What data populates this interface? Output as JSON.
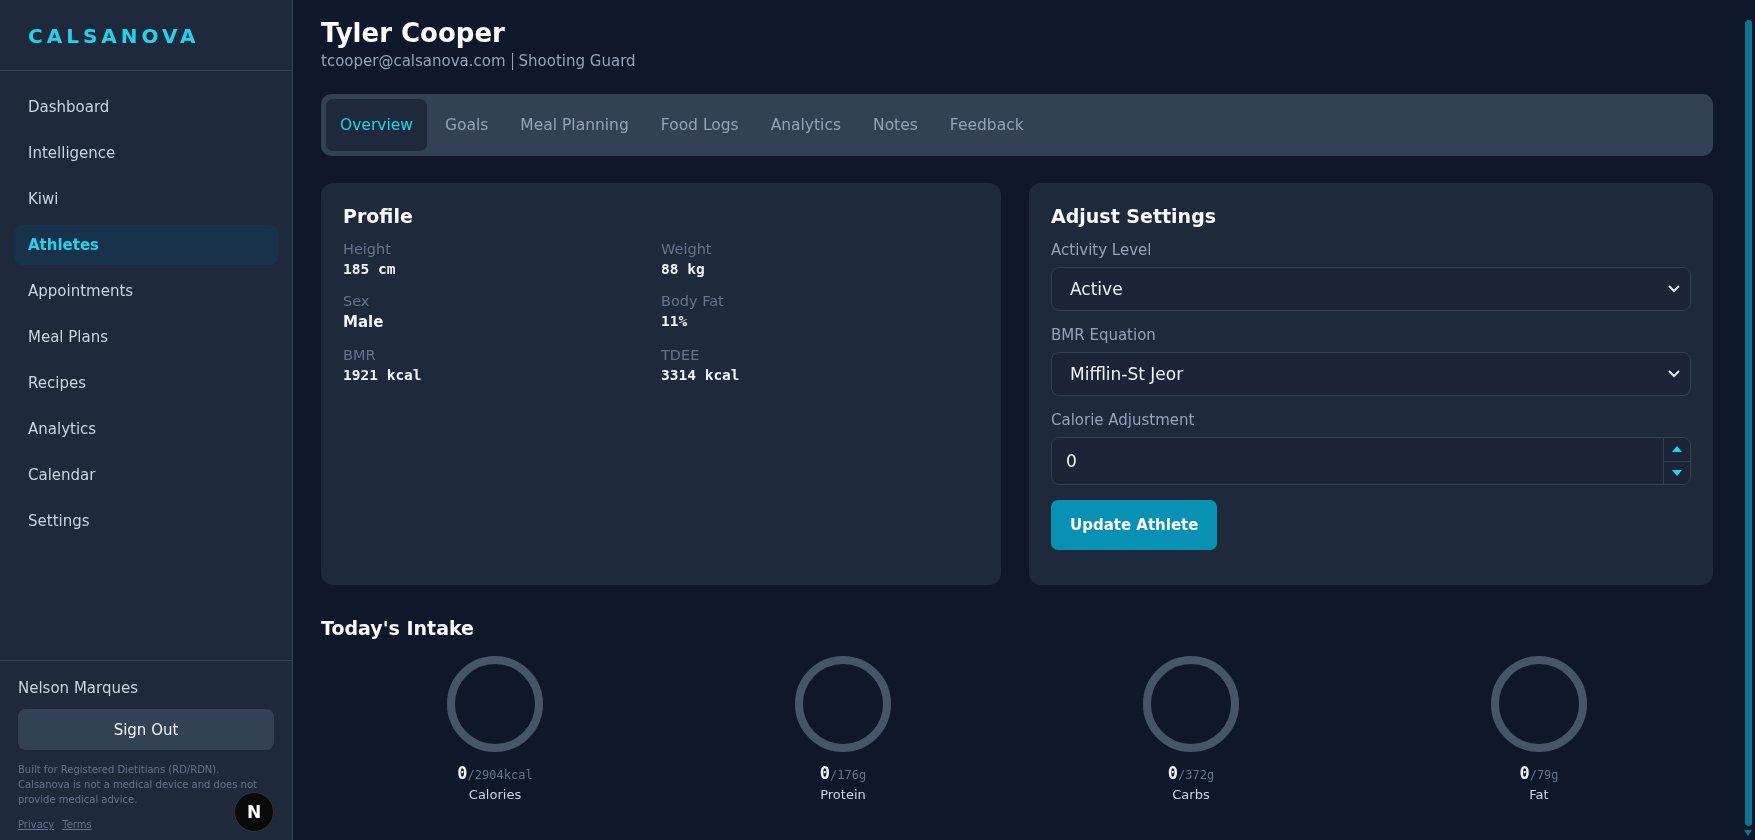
{
  "sidebar": {
    "logo": "CALSANOVA",
    "items": [
      {
        "label": "Dashboard",
        "selected": false
      },
      {
        "label": "Intelligence",
        "selected": false
      },
      {
        "label": "Kiwi",
        "selected": false
      },
      {
        "label": "Athletes",
        "selected": true
      },
      {
        "label": "Appointments",
        "selected": false
      },
      {
        "label": "Meal Plans",
        "selected": false
      },
      {
        "label": "Recipes",
        "selected": false
      },
      {
        "label": "Analytics",
        "selected": false
      },
      {
        "label": "Calendar",
        "selected": false
      },
      {
        "label": "Settings",
        "selected": false
      }
    ],
    "user": "Nelson Marques",
    "sign_out": "Sign Out",
    "disclaimer": "Built for Registered Dietitians (RD/RDN). Calsanova is not a medical device and does not provide medical advice.",
    "links": [
      "Privacy",
      "Terms"
    ],
    "badge": "N"
  },
  "header": {
    "name": "Tyler Cooper",
    "email": "tcooper@calsanova.com",
    "position": "Shooting Guard"
  },
  "tabs": [
    {
      "label": "Overview",
      "selected": true
    },
    {
      "label": "Goals",
      "selected": false
    },
    {
      "label": "Meal Planning",
      "selected": false
    },
    {
      "label": "Food Logs",
      "selected": false
    },
    {
      "label": "Analytics",
      "selected": false
    },
    {
      "label": "Notes",
      "selected": false
    },
    {
      "label": "Feedback",
      "selected": false
    }
  ],
  "profile": {
    "title": "Profile",
    "fields": [
      {
        "label": "Height",
        "value": "185 cm",
        "kind": "mono"
      },
      {
        "label": "Weight",
        "value": "88 kg",
        "kind": "mono"
      },
      {
        "label": "Sex",
        "value": "Male",
        "kind": "text"
      },
      {
        "label": "Body Fat",
        "value": "11%",
        "kind": "mono"
      },
      {
        "label": "BMR",
        "value": "1921 kcal",
        "kind": "mono"
      },
      {
        "label": "TDEE",
        "value": "3314 kcal",
        "kind": "mono"
      }
    ]
  },
  "settings": {
    "title": "Adjust Settings",
    "fields": [
      {
        "label": "Activity Level",
        "value": "Active",
        "kind": "select"
      },
      {
        "label": "BMR Equation",
        "value": "Mifflin-St Jeor",
        "kind": "select"
      },
      {
        "label": "Calorie Adjustment",
        "value": "0",
        "kind": "number"
      }
    ],
    "button": "Update Athlete"
  },
  "intake": {
    "title": "Today's Intake",
    "items": [
      {
        "value": "0",
        "target": "/2904kcal",
        "label": "Calories"
      },
      {
        "value": "0",
        "target": "/176g",
        "label": "Protein"
      },
      {
        "value": "0",
        "target": "/372g",
        "label": "Carbs"
      },
      {
        "value": "0",
        "target": "/79g",
        "label": "Fat"
      }
    ]
  }
}
